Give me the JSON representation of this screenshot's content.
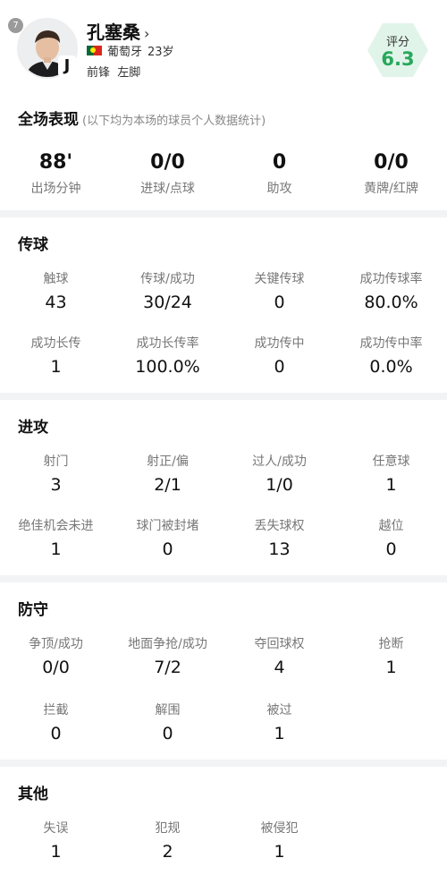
{
  "player": {
    "number": "7",
    "name": "孔塞桑",
    "chevron": "›",
    "nationality": "葡萄牙",
    "age": "23岁",
    "position": "前锋",
    "foot": "左脚",
    "crest_letter": "J",
    "rating_label": "评分",
    "rating_value": "6.3"
  },
  "overview": {
    "title": "全场表现",
    "note": "(以下均为本场的球员个人数据统计)",
    "stats": [
      {
        "value": "88'",
        "label": "出场分钟"
      },
      {
        "value": "0/0",
        "label": "进球/点球"
      },
      {
        "value": "0",
        "label": "助攻"
      },
      {
        "value": "0/0",
        "label": "黄牌/红牌"
      }
    ]
  },
  "passing": {
    "title": "传球",
    "stats": [
      {
        "label": "触球",
        "value": "43"
      },
      {
        "label": "传球/成功",
        "value": "30/24"
      },
      {
        "label": "关键传球",
        "value": "0"
      },
      {
        "label": "成功传球率",
        "value": "80.0%"
      },
      {
        "label": "成功长传",
        "value": "1"
      },
      {
        "label": "成功长传率",
        "value": "100.0%"
      },
      {
        "label": "成功传中",
        "value": "0"
      },
      {
        "label": "成功传中率",
        "value": "0.0%"
      }
    ]
  },
  "attack": {
    "title": "进攻",
    "stats": [
      {
        "label": "射门",
        "value": "3"
      },
      {
        "label": "射正/偏",
        "value": "2/1"
      },
      {
        "label": "过人/成功",
        "value": "1/0"
      },
      {
        "label": "任意球",
        "value": "1"
      },
      {
        "label": "绝佳机会未进",
        "value": "1"
      },
      {
        "label": "球门被封堵",
        "value": "0"
      },
      {
        "label": "丢失球权",
        "value": "13"
      },
      {
        "label": "越位",
        "value": "0"
      }
    ]
  },
  "defense": {
    "title": "防守",
    "stats": [
      {
        "label": "争顶/成功",
        "value": "0/0"
      },
      {
        "label": "地面争抢/成功",
        "value": "7/2"
      },
      {
        "label": "夺回球权",
        "value": "4"
      },
      {
        "label": "抢断",
        "value": "1"
      },
      {
        "label": "拦截",
        "value": "0"
      },
      {
        "label": "解围",
        "value": "0"
      },
      {
        "label": "被过",
        "value": "1"
      }
    ]
  },
  "other": {
    "title": "其他",
    "stats": [
      {
        "label": "失误",
        "value": "1"
      },
      {
        "label": "犯规",
        "value": "2"
      },
      {
        "label": "被侵犯",
        "value": "1"
      }
    ]
  }
}
